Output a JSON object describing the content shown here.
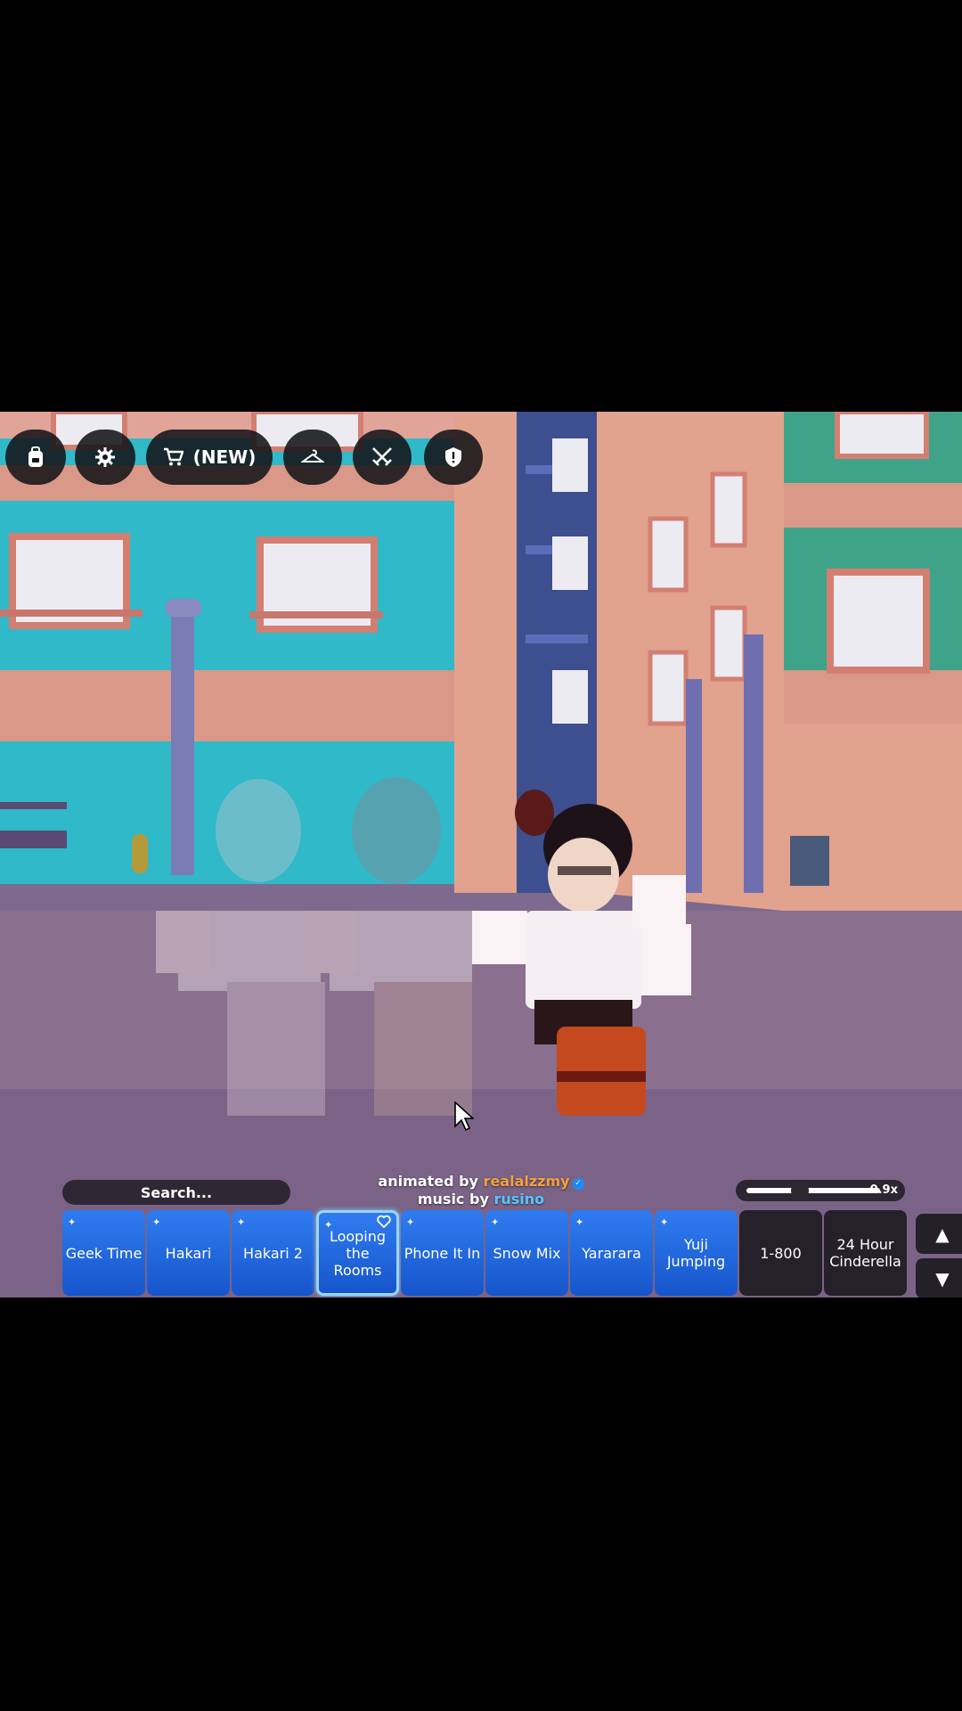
{
  "toolbar": {
    "shop_label": "(NEW)"
  },
  "credits": {
    "animated_prefix": "animated by",
    "animator": "realalzzmy",
    "music_prefix": "music by",
    "musician": "rusino"
  },
  "search": {
    "placeholder": "Search..."
  },
  "speed": {
    "value_label": "0.9x",
    "fraction": 0.4
  },
  "emotes": [
    {
      "label": "Geek Time",
      "sparkle": true
    },
    {
      "label": "Hakari",
      "sparkle": true
    },
    {
      "label": "Hakari 2",
      "sparkle": true
    },
    {
      "label": "Looping the Rooms",
      "sparkle": true,
      "favorite": true,
      "selected": true
    },
    {
      "label": "Phone It In",
      "sparkle": true
    },
    {
      "label": "Snow Mix",
      "sparkle": true
    },
    {
      "label": "Yararara",
      "sparkle": true
    },
    {
      "label": "Yuji Jumping",
      "sparkle": true
    },
    {
      "label": "1-800",
      "sparkle": false
    },
    {
      "label": "24 Hour Cinderella",
      "sparkle": false
    }
  ],
  "scroll": {
    "up_glyph": "▲",
    "down_glyph": "▼"
  },
  "icons": {
    "toolbar": [
      "backpack-icon",
      "gear-icon",
      "cart-icon",
      "hanger-icon",
      "crossed-swords-icon",
      "shield-icon"
    ]
  },
  "colors": {
    "emote_blue": "#1f66dc",
    "toolbar_bg": "#141418",
    "animator_orange": "#f2a23a",
    "musician_blue": "#57c8ff"
  }
}
